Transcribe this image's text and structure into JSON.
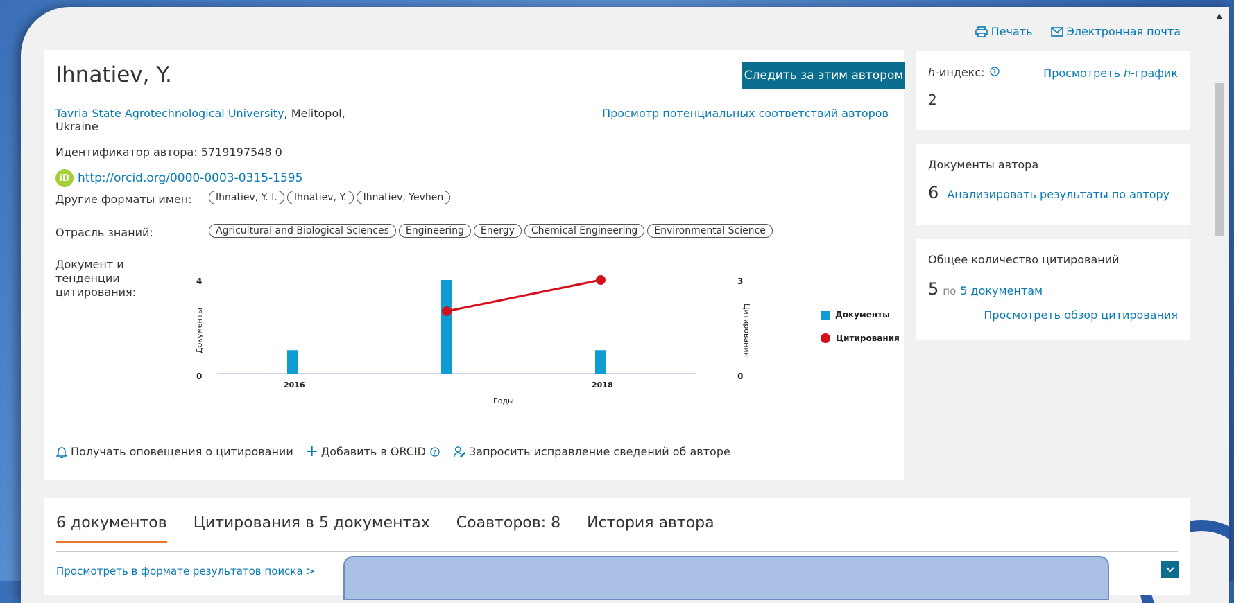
{
  "toolbar": {
    "print": "Печать",
    "email": "Электронная почта"
  },
  "author": {
    "name": "Ihnatiev, Y.",
    "follow_label": "Следить за этим автором",
    "affiliation_link": "Tavria State Agrotechnological University",
    "affiliation_rest": ", Melitopol,",
    "affiliation_country": "Ukraine",
    "potential_matches": "Просмотр потенциальных соответствий авторов",
    "author_id_label": "Идентификатор автора: 5719197548 0",
    "orcid_url": "http://orcid.org/0000-0003-0315-1595",
    "other_names_label": "Другие форматы имен:",
    "other_names": [
      "Ihnatiev, Y. I.",
      "Ihnatiev, Y.",
      "Ihnatiev, Yevhen"
    ],
    "subject_label": "Отрасль знаний:",
    "subjects": [
      "Agricultural and Biological Sciences",
      "Engineering",
      "Energy",
      "Chemical Engineering",
      "Environmental Science"
    ],
    "trends_label": "Документ и тенденции цитирования:"
  },
  "chart_data": {
    "type": "bar",
    "x": [
      2016,
      2017,
      2018
    ],
    "x_tick_labels": [
      "2016",
      "",
      "2018"
    ],
    "xlabel": "Годы",
    "ylabel_left": "Документы",
    "ylabel_right": "Цитирования",
    "ylim_left": [
      0,
      4
    ],
    "ylim_right": [
      0,
      3
    ],
    "left_ticks": [
      "0",
      "4"
    ],
    "right_ticks": [
      "0",
      "3"
    ],
    "series": [
      {
        "name": "Документы",
        "type": "bar",
        "axis": "left",
        "values": [
          1,
          4,
          1
        ],
        "color": "#0e9dd3"
      },
      {
        "name": "Цитирования",
        "type": "line",
        "axis": "right",
        "x": [
          2017,
          2018
        ],
        "values": [
          2,
          3
        ],
        "color": "#d3111b"
      }
    ],
    "legend": "right"
  },
  "actions": {
    "alerts": "Получать оповещения о цитировании",
    "orcid": "Добавить в ORCID",
    "correction": "Запросить исправление сведений об авторе"
  },
  "hindex": {
    "label": "-индекс:",
    "prefix": "h",
    "view_prefix": "Просмотреть ",
    "view_h": "h",
    "view_suffix": "-график",
    "value": "2"
  },
  "docs": {
    "title": "Документы автора",
    "count": "6",
    "analyze": "Анализировать результаты по автору"
  },
  "cites": {
    "title": "Общее количество цитирований",
    "count": "5",
    "by": "по",
    "docs_link": "5 документам",
    "overview": "Просмотреть обзор цитирования"
  },
  "tabs": [
    "6 документов",
    "Цитирования в 5 документах",
    "Соавторов: 8",
    "История автора"
  ],
  "view_search": "Просмотреть в формате результатов поиска >"
}
